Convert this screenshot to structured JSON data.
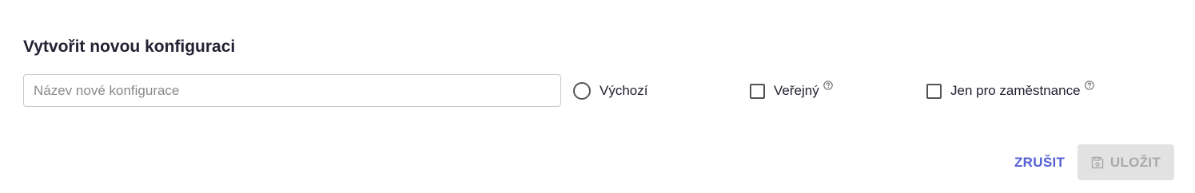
{
  "form": {
    "title": "Vytvořit novou konfiguraci",
    "name_input": {
      "value": "",
      "placeholder": "Název nové konfigurace"
    },
    "options": {
      "default_label": "Výchozí",
      "public_label": "Veřejný",
      "employees_only_label": "Jen pro zaměstnance"
    },
    "actions": {
      "cancel_label": "ZRUŠIT",
      "save_label": "ULOŽIT"
    }
  },
  "icons": {
    "help": "help-circle-icon",
    "save": "floppy-disk-icon"
  },
  "colors": {
    "accent": "#5561d6",
    "disabled_bg": "#e2e2e2",
    "disabled_text": "#a9a9a9"
  }
}
